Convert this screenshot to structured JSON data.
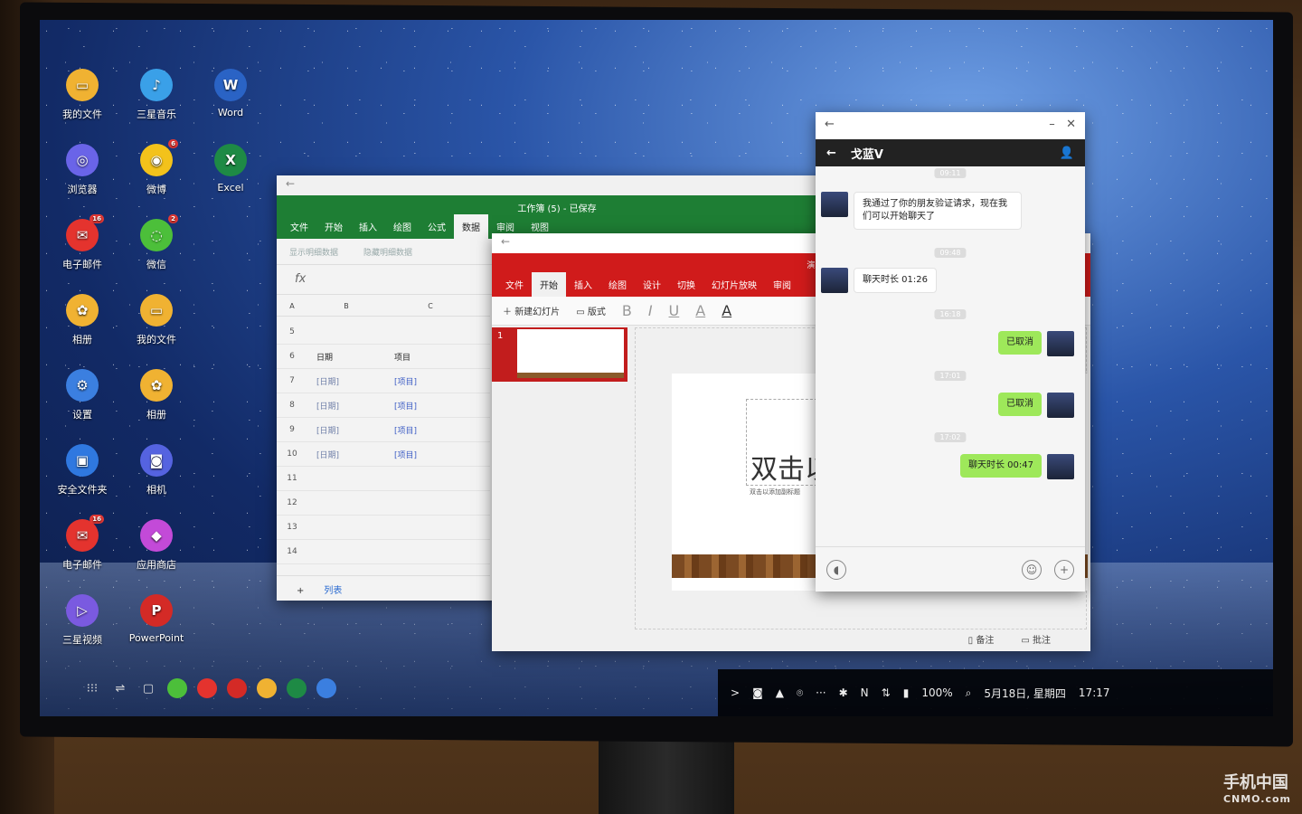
{
  "desktop": {
    "icons": [
      {
        "label": "我的文件",
        "icon": "folder-icon",
        "color": "#f0b232",
        "glyph": "▭",
        "col": 0,
        "row": 0
      },
      {
        "label": "三星音乐",
        "icon": "music-icon",
        "color": "#3aa0e8",
        "glyph": "♪",
        "col": 1,
        "row": 0
      },
      {
        "label": "Word",
        "icon": "word-icon",
        "color": "#2a63c5",
        "glyph": "W",
        "col": 2,
        "row": 0
      },
      {
        "label": "浏览器",
        "icon": "browser-icon",
        "color": "#6a64e8",
        "glyph": "◎",
        "col": 0,
        "row": 1
      },
      {
        "label": "微博",
        "icon": "weibo-icon",
        "color": "#f3c21b",
        "glyph": "◉",
        "badge": "6",
        "col": 1,
        "row": 1
      },
      {
        "label": "Excel",
        "icon": "excel-icon",
        "color": "#1e8a45",
        "glyph": "X",
        "col": 2,
        "row": 1
      },
      {
        "label": "电子邮件",
        "icon": "email-icon",
        "color": "#e4332e",
        "glyph": "✉",
        "badge": "16",
        "col": 0,
        "row": 2
      },
      {
        "label": "微信",
        "icon": "wechat-icon",
        "color": "#4cbf3a",
        "glyph": "◌",
        "badge": "2",
        "col": 1,
        "row": 2
      },
      {
        "label": "相册",
        "icon": "gallery-icon",
        "color": "#f0b232",
        "glyph": "✿",
        "col": 0,
        "row": 3
      },
      {
        "label": "我的文件",
        "icon": "folder-icon",
        "color": "#f0b232",
        "glyph": "▭",
        "col": 1,
        "row": 3
      },
      {
        "label": "设置",
        "icon": "settings-icon",
        "color": "#3b7fe0",
        "glyph": "⚙",
        "col": 0,
        "row": 4
      },
      {
        "label": "相册",
        "icon": "gallery-icon",
        "color": "#f0b232",
        "glyph": "✿",
        "col": 1,
        "row": 4
      },
      {
        "label": "安全文件夹",
        "icon": "secure-folder-icon",
        "color": "#2f78e0",
        "glyph": "▣",
        "col": 0,
        "row": 5
      },
      {
        "label": "相机",
        "icon": "camera-icon",
        "color": "#5563e0",
        "glyph": "◙",
        "col": 1,
        "row": 5
      },
      {
        "label": "电子邮件",
        "icon": "email-icon",
        "color": "#e4332e",
        "glyph": "✉",
        "badge": "16",
        "col": 0,
        "row": 6
      },
      {
        "label": "应用商店",
        "icon": "store-icon",
        "color": "#c34ad8",
        "glyph": "◆",
        "col": 1,
        "row": 6
      },
      {
        "label": "三星视频",
        "icon": "video-icon",
        "color": "#7a5ae0",
        "glyph": "▷",
        "col": 0,
        "row": 7
      },
      {
        "label": "PowerPoint",
        "icon": "powerpoint-icon",
        "color": "#d42a26",
        "glyph": "P",
        "col": 1,
        "row": 7
      }
    ]
  },
  "taskbar": {
    "left_controls": [
      "⁝⁝⁝",
      "⇌",
      "▢"
    ],
    "apps": [
      {
        "icon": "wechat-icon",
        "color": "#4cbf3a"
      },
      {
        "icon": "email-icon",
        "color": "#e4332e"
      },
      {
        "icon": "powerpoint-icon",
        "color": "#d42a26"
      },
      {
        "icon": "folder-icon",
        "color": "#f0b232"
      },
      {
        "icon": "excel-icon",
        "color": "#1e8a45"
      },
      {
        "icon": "settings-icon",
        "color": "#3b7fe0"
      }
    ],
    "tray": {
      "glyphs": [
        ">",
        "◙",
        "▲",
        "⌾",
        "···",
        "✱",
        "N",
        "⇅",
        "▮"
      ],
      "battery": "100%",
      "clock_date": "5月18日, 星期四",
      "clock_time": "17:17"
    }
  },
  "excel": {
    "title": "工作簿 (5) - 已保存",
    "tabs": [
      "文件",
      "开始",
      "插入",
      "绘图",
      "公式",
      "数据",
      "审阅",
      "视图"
    ],
    "active_tab": "数据",
    "tools": [
      "显示明细数据",
      "隐藏明细数据"
    ],
    "fx": "fx",
    "col_headers": [
      "A",
      "B",
      "C"
    ],
    "rows": [
      {
        "n": "5",
        "a": "",
        "b": ""
      },
      {
        "n": "6",
        "a": "日期",
        "b": "项目"
      },
      {
        "n": "7",
        "a": "[日期]",
        "b": "[项目]"
      },
      {
        "n": "8",
        "a": "[日期]",
        "b": "[项目]"
      },
      {
        "n": "9",
        "a": "[日期]",
        "b": "[项目]"
      },
      {
        "n": "10",
        "a": "[日期]",
        "b": "[项目]"
      },
      {
        "n": "11",
        "a": "",
        "b": ""
      },
      {
        "n": "12",
        "a": "",
        "b": ""
      },
      {
        "n": "13",
        "a": "",
        "b": ""
      },
      {
        "n": "14",
        "a": "",
        "b": ""
      }
    ],
    "sheet_tab": "列表"
  },
  "ppt": {
    "title": "演示文稿 (4)",
    "tabs": [
      "文件",
      "开始",
      "插入",
      "绘图",
      "设计",
      "切换",
      "幻灯片放映",
      "审阅"
    ],
    "active_tab": "开始",
    "new_slide": "新建幻灯片",
    "layout": "版式",
    "format": [
      "B",
      "I",
      "U",
      "A",
      "A"
    ],
    "slide_number": "1",
    "slide_title": "双击以",
    "slide_subtitle": "双击以添加副标题",
    "footer_notes": "备注",
    "footer_comments": "批注"
  },
  "chat": {
    "contact": "戈蓝V",
    "messages": [
      {
        "side": "l",
        "text": "我通过了你的朋友验证请求，现在我们可以开始聊天了"
      },
      {
        "side": "l",
        "text": "聊天时长 01:26"
      },
      {
        "side": "r",
        "text": "已取消"
      },
      {
        "side": "r",
        "text": "已取消"
      },
      {
        "side": "r",
        "text": "聊天时长 00:47"
      }
    ],
    "timestamps": [
      "09:11",
      "09:48",
      "16:18",
      "17:01",
      "17:02"
    ]
  },
  "watermark": {
    "line1": "手机中国",
    "line2": "CNMO.com"
  }
}
